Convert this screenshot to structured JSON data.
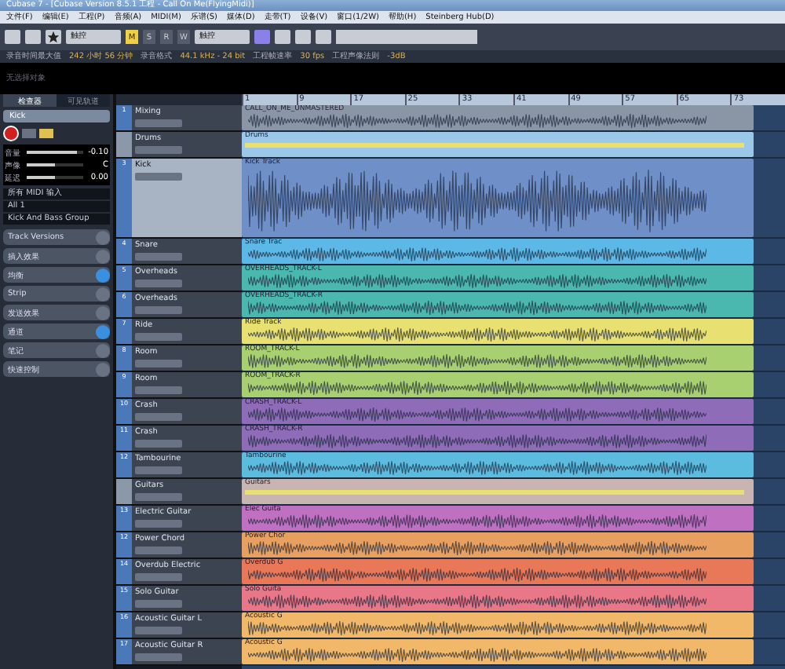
{
  "window": {
    "title": "Cubase 7 - [Cubase Version 8.5.1 工程 - Call On Me(FlyingMidi)]"
  },
  "menu": [
    "文件(F)",
    "编辑(E)",
    "工程(P)",
    "音频(A)",
    "MIDI(M)",
    "乐谱(S)",
    "媒体(D)",
    "走带(T)",
    "设备(V)",
    "窗口(1/2W)",
    "帮助(H)",
    "Steinberg Hub(D)"
  ],
  "toolbar": {
    "mode_dropdown": "触控",
    "msrw": [
      {
        "label": "M",
        "on": true
      },
      {
        "label": "S",
        "on": false
      },
      {
        "label": "R",
        "on": false
      },
      {
        "label": "W",
        "on": false
      }
    ],
    "automation_dropdown": "触控"
  },
  "status_line": [
    "录音时间最大值",
    "242 小时 56 分钟",
    "录音格式",
    "44.1 kHz - 24 bit",
    "工程帧速率",
    "30 fps",
    "工程声像法则",
    "-3dB"
  ],
  "info_line": "无选择对象",
  "inspector": {
    "tabs": [
      {
        "label": "检查器",
        "selected": true
      },
      {
        "label": "可见轨道",
        "selected": false
      }
    ],
    "track_name": "Kick",
    "params": [
      {
        "label": "音量",
        "value": "-0.10",
        "level": 0.9
      },
      {
        "label": "声像",
        "value": "C",
        "level": 0.5
      },
      {
        "label": "延迟",
        "value": "0.00",
        "level": 0.5
      }
    ],
    "routing": [
      "所有 MIDI 输入",
      "All 1",
      "Kick And Bass Group"
    ],
    "sections": [
      {
        "label": "Track Versions",
        "active": false
      },
      {
        "label": "插入效果",
        "active": false
      },
      {
        "label": "均衡",
        "active": true
      },
      {
        "label": "Strip",
        "active": false
      },
      {
        "label": "发送效果",
        "active": false
      },
      {
        "label": "通道",
        "active": true
      },
      {
        "label": "笔记",
        "active": false
      },
      {
        "label": "快速控制",
        "active": false
      }
    ]
  },
  "ruler": [
    "1",
    "9",
    "17",
    "25",
    "33",
    "41",
    "49",
    "57",
    "65",
    "73"
  ],
  "tracks": [
    {
      "number": "1",
      "name": "Mixing",
      "kind": "audio",
      "selected": false,
      "event": "CALL_ON_ME_UNMASTERED",
      "color": "#8a96a6"
    },
    {
      "name": "Drums",
      "kind": "folder",
      "selected": false,
      "event": "Drums",
      "color": "#9bc8e8"
    },
    {
      "number": "3",
      "name": "Kick",
      "kind": "audio",
      "selected": true,
      "event": "Kick Track",
      "color": "#6e8fc8"
    },
    {
      "number": "4",
      "name": "Snare",
      "kind": "audio",
      "selected": false,
      "event": "Snare Trac",
      "color": "#5cb8e6"
    },
    {
      "number": "5",
      "name": "Overheads",
      "kind": "audio",
      "selected": false,
      "event": "OVERHEADS_TRACK-L",
      "color": "#4bb8b0"
    },
    {
      "number": "6",
      "name": "Overheads",
      "kind": "audio",
      "selected": false,
      "event": "OVERHEADS_TRACK-R",
      "color": "#4bb8b0"
    },
    {
      "number": "7",
      "name": "Ride",
      "kind": "audio",
      "selected": false,
      "event": "Ride Track",
      "color": "#e8e070"
    },
    {
      "number": "8",
      "name": "Room",
      "kind": "audio",
      "selected": false,
      "event": "ROOM_TRACK-L",
      "color": "#a8d070"
    },
    {
      "number": "9",
      "name": "Room",
      "kind": "audio",
      "selected": false,
      "event": "ROOM_TRACK-R",
      "color": "#a8d070"
    },
    {
      "number": "10",
      "name": "Crash",
      "kind": "audio",
      "selected": false,
      "event": "CRASH_TRACK-L",
      "color": "#8e6cb8"
    },
    {
      "number": "11",
      "name": "Crash",
      "kind": "audio",
      "selected": false,
      "event": "CRASH_TRACK-R",
      "color": "#8e6cb8"
    },
    {
      "number": "12",
      "name": "Tambourine",
      "kind": "audio",
      "selected": false,
      "event": "Tambourine",
      "color": "#5cbce0"
    },
    {
      "name": "Guitars",
      "kind": "folder",
      "selected": false,
      "event": "Guitars",
      "color": "#c8b4b0"
    },
    {
      "number": "13",
      "name": "Electric Guitar",
      "kind": "audio",
      "selected": false,
      "event": "Elec Guita",
      "color": "#c070c0"
    },
    {
      "number": "12",
      "name": "Power Chord",
      "kind": "audio",
      "selected": false,
      "event": "Power Chor",
      "color": "#e8a060"
    },
    {
      "number": "14",
      "name": "Overdub Electric",
      "kind": "audio",
      "selected": false,
      "event": "Overdub G",
      "color": "#e87858"
    },
    {
      "number": "15",
      "name": "Solo Guitar",
      "kind": "audio",
      "selected": false,
      "event": "Solo Guita",
      "color": "#e87888"
    },
    {
      "number": "16",
      "name": "Acoustic Guitar L",
      "kind": "audio",
      "selected": false,
      "event": "Acoustic G",
      "color": "#f0b868"
    },
    {
      "number": "17",
      "name": "Acoustic Guitar R",
      "kind": "audio",
      "selected": false,
      "event": "Acoustic G",
      "color": "#f0b868"
    }
  ]
}
